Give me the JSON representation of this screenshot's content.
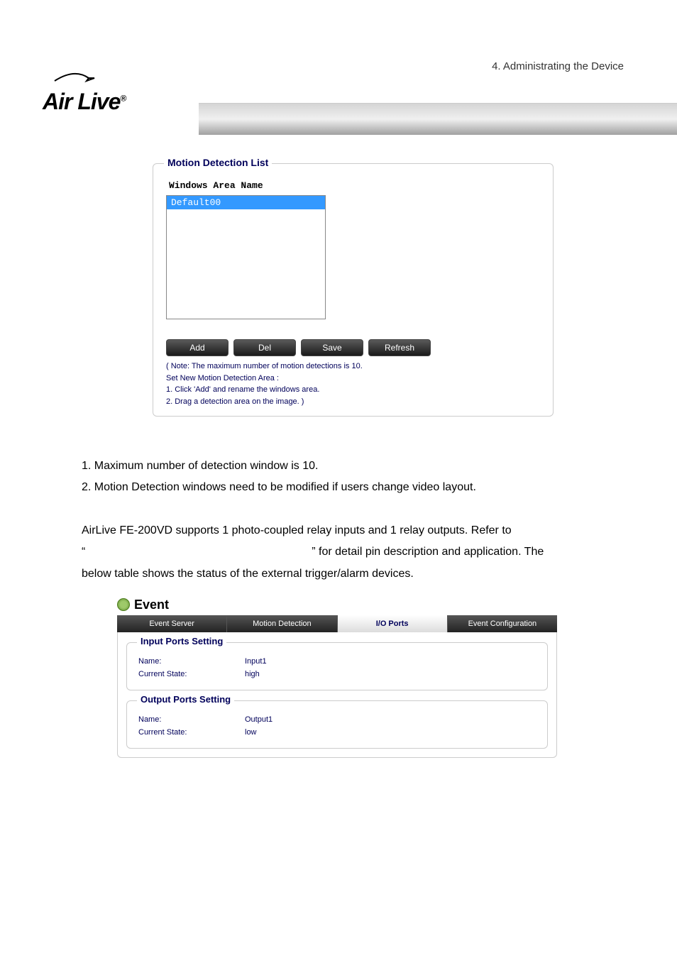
{
  "chapter": "4.  Administrating  the  Device",
  "logo_text": "Air Live",
  "motion_panel": {
    "legend": "Motion Detection List",
    "area_label": "Windows Area Name",
    "items": [
      "Default00"
    ],
    "buttons": {
      "add": "Add",
      "del": "Del",
      "save": "Save",
      "refresh": "Refresh"
    },
    "note_line1": "( Note: The maximum number of motion detections is 10.",
    "note_line2": "Set New Motion Detection Area :",
    "note_line3": "1. Click 'Add' and rename the windows area.",
    "note_line4": "2. Drag a detection area on the image. )"
  },
  "body_text": {
    "li1": "1. Maximum number of detection window is 10.",
    "li2": "2. Motion Detection windows need to be modified if users change video layout.",
    "p1_a": "AirLive FE-200VD supports 1 photo-coupled relay inputs and 1 relay outputs. Refer to",
    "p1_b": "“",
    "p1_c": "” for detail pin description and application.   The",
    "p2": "below table shows the status of the external trigger/alarm devices."
  },
  "event_widget": {
    "title": "Event",
    "tabs": {
      "server": "Event Server",
      "motion": "Motion Detection",
      "io": "I/O Ports",
      "config": "Event Configuration"
    },
    "input_legend": "Input Ports Setting",
    "output_legend": "Output Ports Setting",
    "name_label": "Name:",
    "state_label": "Current State:",
    "input_name": "Input1",
    "input_state": "high",
    "output_name": "Output1",
    "output_state": "low"
  }
}
